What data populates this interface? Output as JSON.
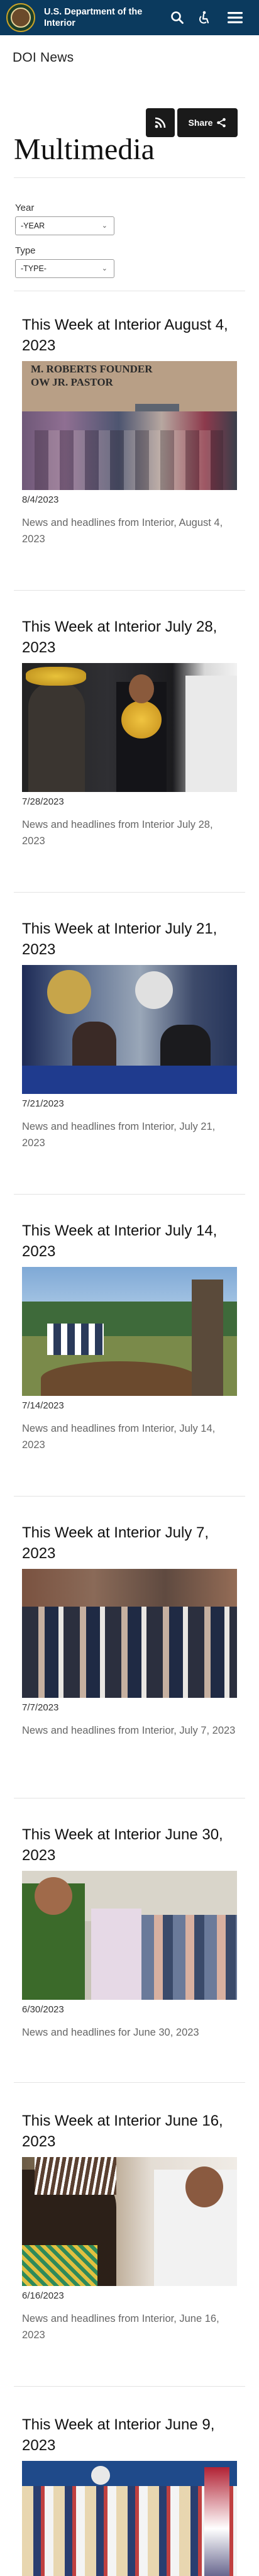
{
  "header": {
    "agency_line1": "U.S. Department of the",
    "agency_line2": "Interior",
    "icons": [
      "search-icon",
      "accessibility-icon",
      "menu-icon"
    ]
  },
  "section": {
    "label": "DOI News"
  },
  "actions": {
    "share_label": "Share"
  },
  "page": {
    "title": "Multimedia"
  },
  "filters": {
    "year_label": "Year",
    "year_value": "-YEAR",
    "type_label": "Type",
    "type_value": "-TYPE-"
  },
  "cards": [
    {
      "title": "This Week at Interior August 4, 2023",
      "date": "8/4/2023",
      "description": "News and headlines from Interior, August 4, 2023",
      "image_text_line1": "M. ROBERTS FOUNDER",
      "image_text_line2": "OW JR. PASTOR"
    },
    {
      "title": "This Week at Interior July 28, 2023",
      "date": "7/28/2023",
      "description": "News and headlines from Interior July 28, 2023"
    },
    {
      "title": "This Week at Interior July 21, 2023",
      "date": "7/21/2023",
      "description": "News and headlines from Interior, July 21, 2023"
    },
    {
      "title": "This Week at Interior July 14, 2023",
      "date": "7/14/2023",
      "description": "News and headlines from Interior, July 14, 2023"
    },
    {
      "title": "This Week at Interior July 7, 2023",
      "date": "7/7/2023",
      "description": "News and headlines from Interior, July 7, 2023"
    },
    {
      "title": "This Week at Interior June 30, 2023",
      "date": "6/30/2023",
      "description": "News and headlines for June 30, 2023"
    },
    {
      "title": "This Week at Interior June 16, 2023",
      "date": "6/16/2023",
      "description": "News and headlines from Interior, June 16, 2023"
    },
    {
      "title": "This Week at Interior June 9, 2023"
    }
  ],
  "colors": {
    "header_bg": "#0b3a5e",
    "button_bg": "#1a1a1a",
    "description_text": "#666666"
  }
}
